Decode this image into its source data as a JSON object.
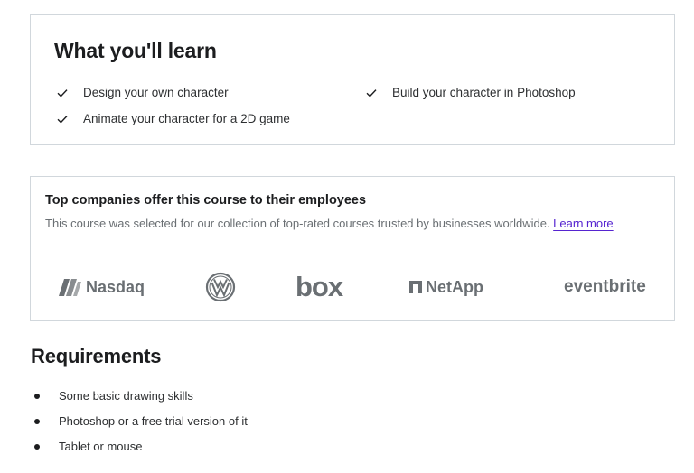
{
  "learn": {
    "title": "What you'll learn",
    "items": [
      "Design your own character",
      "Build your character in Photoshop",
      "Animate your character for a 2D game"
    ]
  },
  "companies": {
    "title": "Top companies offer this course to their employees",
    "description": "This course was selected for our collection of top-rated courses trusted by businesses worldwide.",
    "link_label": "Learn more",
    "logos": [
      "Nasdaq",
      "Volkswagen",
      "box",
      "NetApp",
      "eventbrite"
    ]
  },
  "requirements": {
    "title": "Requirements",
    "items": [
      "Some basic drawing skills",
      "Photoshop or a free trial version of it",
      "Tablet or mouse"
    ]
  },
  "colors": {
    "link": "#5624d0",
    "border": "#d1d7dc",
    "muted_text": "#6a6f73"
  }
}
